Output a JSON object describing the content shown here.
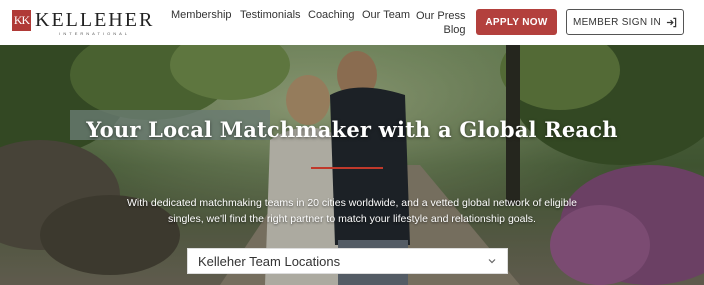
{
  "header": {
    "logo_mark": "KK",
    "logo_name": "KELLEHER",
    "logo_sub": "INTERNATIONAL",
    "nav": [
      {
        "label": "Membership"
      },
      {
        "label": "Testimonials"
      },
      {
        "label": "Coaching"
      },
      {
        "label": "Our Team"
      },
      {
        "label": "Our Press",
        "label2": "Blog"
      }
    ],
    "apply_label": "APPLY NOW",
    "signin_label": "MEMBER SIGN IN",
    "signin_icon": "sign-in-icon"
  },
  "hero": {
    "title": "Your Local Matchmaker with a Global Reach",
    "description": "With dedicated matchmaking teams in 20 cities worldwide, and a vetted global network of eligible singles, we'll find the right partner to match your lifestyle and relationship goals.",
    "select_value": "Kelleher Team Locations"
  },
  "colors": {
    "accent": "#b3403d",
    "rule": "#c0392b"
  }
}
